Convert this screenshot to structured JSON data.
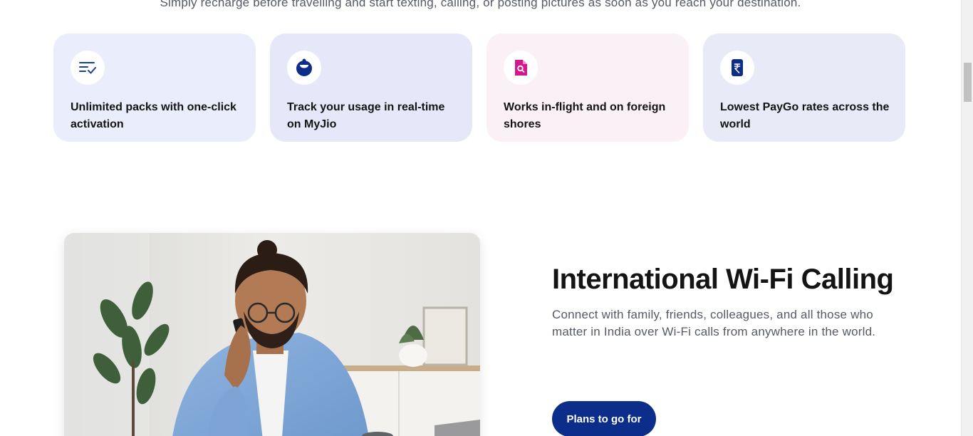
{
  "intro": {
    "text": "Simply recharge before travelling and start texting, calling, or posting pictures as soon as you reach your destination."
  },
  "features": [
    {
      "label": "Unlimited packs with one-click activation",
      "icon": "checklist-icon",
      "bg": "#eaedfb",
      "icon_color": "#1a3ea8"
    },
    {
      "label": "Track your usage in real-time on MyJio",
      "icon": "myjio-icon",
      "bg": "#e6e8f9",
      "icon_color": "#0c2d8a"
    },
    {
      "label": "Works in-flight and on foreign shores",
      "icon": "document-search-icon",
      "bg": "#fcf0f7",
      "icon_color": "#d4178a"
    },
    {
      "label": "Lowest PayGo rates across the world",
      "icon": "rupee-phone-icon",
      "bg": "#e8eaf7",
      "icon_color": "#0c2d8a"
    }
  ],
  "wifi": {
    "title": "International Wi-Fi Calling",
    "description": "Connect with family, friends, colleagues, and all those who matter in India over Wi-Fi calls from anywhere in the world.",
    "button_label": "Plans to go for"
  },
  "colors": {
    "primary": "#0c2d8a",
    "text_dark": "#141414",
    "text_muted": "#555a66"
  }
}
